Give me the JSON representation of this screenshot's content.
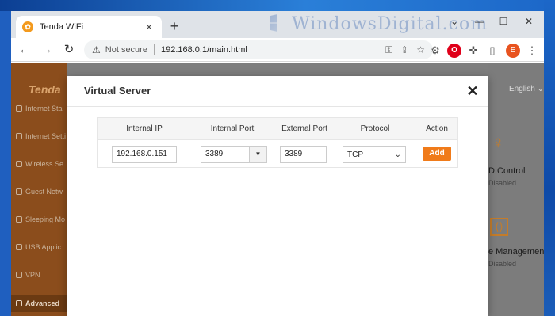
{
  "browser": {
    "tab_title": "Tenda WiFi",
    "tab_close": "✕",
    "new_tab": "+",
    "watermark": "WindowsDigital.com",
    "window_buttons": {
      "minimize": "⌄",
      "min": "—",
      "maximize": "☐",
      "close": "✕"
    },
    "nav": {
      "back": "←",
      "forward": "→",
      "reload": "↻"
    },
    "security_icon": "⚠",
    "security_label": "Not secure",
    "url": "192.168.0.1/main.html",
    "omnibox_icons": [
      "key-icon",
      "share-icon",
      "star-icon"
    ],
    "omnibox_glyphs": [
      "⚿",
      "⇪",
      "☆"
    ],
    "extensions": {
      "gear": "⚙",
      "opera": "O",
      "puzzle": "✜",
      "sidepanel": "▯",
      "profile": "E",
      "menu": "⋮"
    }
  },
  "router": {
    "brand": "Tenda",
    "language": "English",
    "sidebar_items": [
      {
        "label": "Internet Sta",
        "active": false
      },
      {
        "label": "Internet Setti",
        "active": false
      },
      {
        "label": "Wireless Se",
        "active": false
      },
      {
        "label": "Guest Netw",
        "active": false
      },
      {
        "label": "Sleeping Mo",
        "active": false
      },
      {
        "label": "USB Applic",
        "active": false
      },
      {
        "label": "VPN",
        "active": false
      },
      {
        "label": "Advanced",
        "active": true
      }
    ],
    "cards": [
      {
        "title": "D Control",
        "status": "Disabled",
        "icon": "lightbulb-icon",
        "glyph": "♀"
      },
      {
        "title": "e Management",
        "status": "Disabled",
        "icon": "monitor-code-icon",
        "glyph": "⟨⟩"
      }
    ]
  },
  "modal": {
    "title": "Virtual Server",
    "close": "✕",
    "table": {
      "headers": [
        "Internal IP",
        "Internal Port",
        "External Port",
        "Protocol",
        "Action"
      ],
      "row": {
        "internal_ip": "192.168.0.151",
        "internal_port": "3389",
        "internal_port_caret": "▼",
        "external_port": "3389",
        "protocol": "TCP",
        "protocol_caret": "⌄",
        "action": "Add"
      }
    }
  },
  "colors": {
    "accent": "#f07b1a",
    "sidebar": "#8b4d1c",
    "overlay": "#7d7d7d"
  }
}
